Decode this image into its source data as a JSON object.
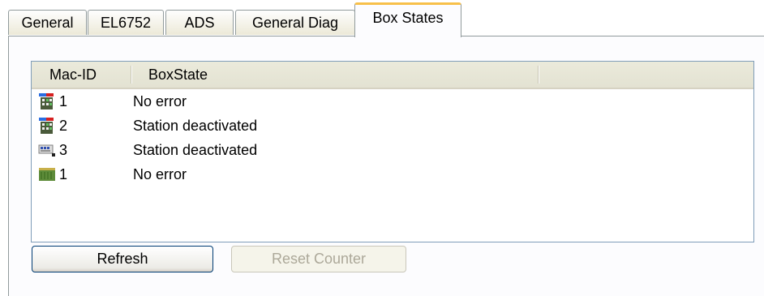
{
  "tabs": [
    {
      "label": "General"
    },
    {
      "label": "EL6752"
    },
    {
      "label": "ADS"
    },
    {
      "label": "General Diag"
    },
    {
      "label": "Box States"
    }
  ],
  "active_tab": "Box States",
  "list": {
    "columns": [
      "Mac-ID",
      "BoxState"
    ],
    "rows": [
      {
        "icon": "io-box-icon",
        "mac_id": "1",
        "box_state": "No error"
      },
      {
        "icon": "io-box-icon",
        "mac_id": "2",
        "box_state": "Station deactivated"
      },
      {
        "icon": "device-module-icon",
        "mac_id": "3",
        "box_state": "Station deactivated"
      },
      {
        "icon": "terminal-block-icon",
        "mac_id": "1",
        "box_state": "No error"
      }
    ]
  },
  "buttons": {
    "refresh": "Refresh",
    "reset_counter": "Reset Counter"
  },
  "colors": {
    "active_tab_accent": "#f7c04a",
    "list_border": "#7f9db9",
    "button_border": "#003c74",
    "disabled_text": "#aca899"
  }
}
